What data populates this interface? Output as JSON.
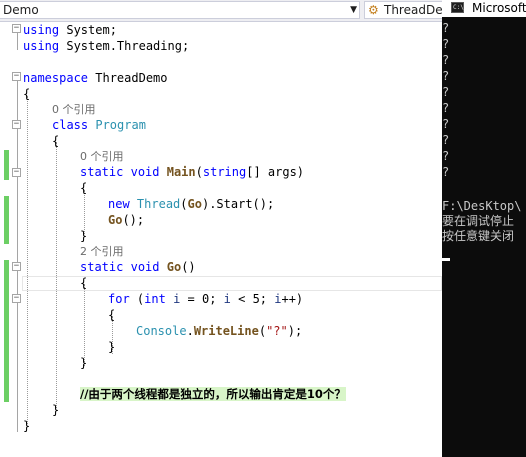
{
  "navbar": {
    "left_combo": "Demo",
    "right_combo": "ThreadDemo",
    "class_icon": "class-icon"
  },
  "code": {
    "line_1_kw": "using",
    "line_1_rest": " System;",
    "line_2_kw": "using",
    "line_2_rest": " System.Threading;",
    "line_4_kw": "namespace",
    "line_4_rest": " ThreadDemo",
    "brace_open": "{",
    "brace_close": "}",
    "ref_0": "0 个引用",
    "ref_2": "2 个引用",
    "class_kw": "class",
    "class_name": "Program",
    "static_kw": "static",
    "void_kw": "void",
    "main_name": "Main",
    "string_kw": "string",
    "args_text": "[] args)",
    "paren_open": "(",
    "new_kw": "new",
    "thread_cls": "Thread",
    "go_name": "Go",
    "start_call": ").Start();",
    "go_call": "();",
    "go_decl_paren": "()",
    "for_kw": "for",
    "int_kw": "int",
    "loop_var": "i",
    "loop_rest_1": " = 0; ",
    "loop_rest_2": " < 5; ",
    "loop_rest_3": "++)",
    "console_cls": "Console",
    "writeline_name": "WriteLine",
    "writeline_str": "\"?\"",
    "writeline_end": ");",
    "dot": ".",
    "comment": "//由于两个线程都是独立的，所以输出肯定是10个？"
  },
  "console": {
    "title": "Microsoft",
    "icon": "console-app-icon",
    "output_lines": [
      "?",
      "?",
      "?",
      "?",
      "?",
      "?",
      "?",
      "?",
      "?",
      "?"
    ],
    "path_line": "F:\\DesKtop\\",
    "debug_line": "要在调试停止",
    "press_key_line": "按任意键关闭"
  },
  "colors": {
    "keyword": "#0000ff",
    "type": "#2b91af",
    "method": "#74531f",
    "variable": "#1f377f",
    "string": "#a31515",
    "change_bar": "#6ccf64",
    "comment_highlight": "#d8f5c8",
    "console_bg": "#0c0c0c"
  }
}
